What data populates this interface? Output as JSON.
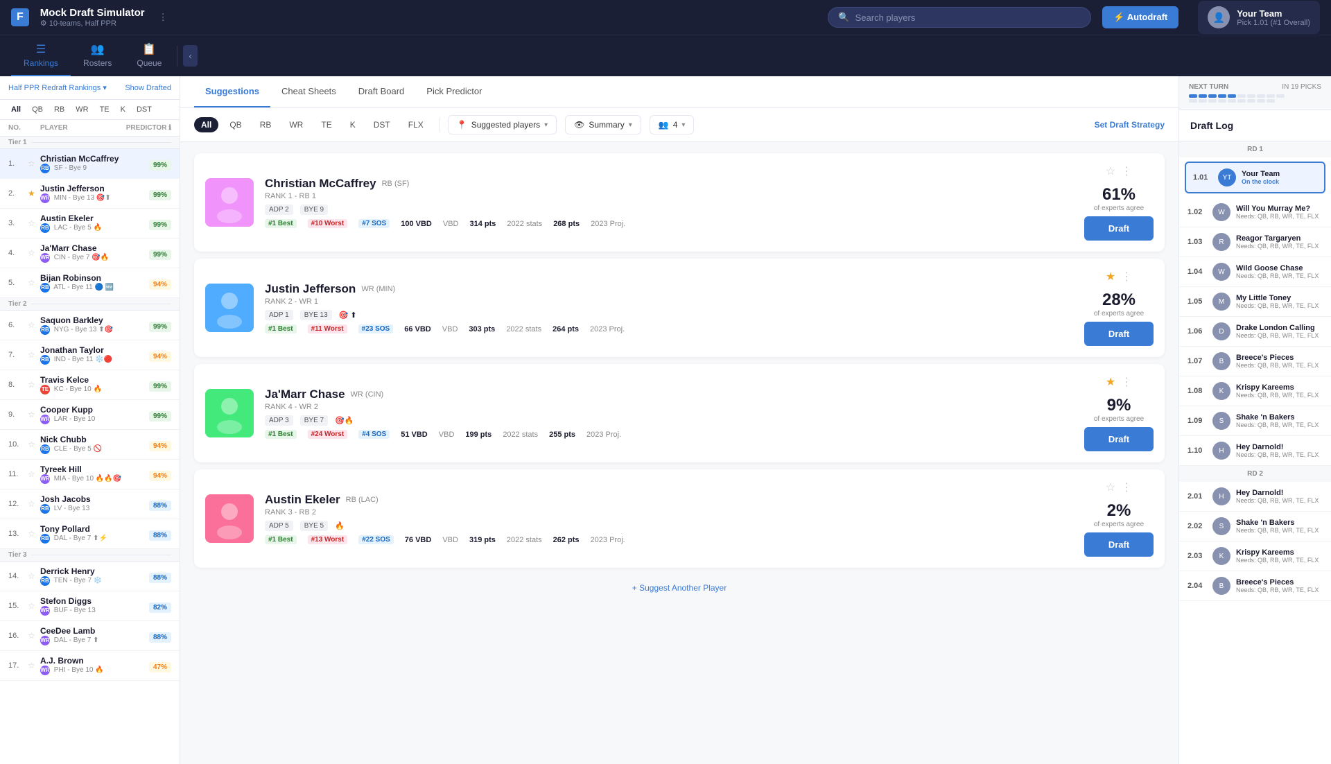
{
  "app": {
    "logo": "F",
    "title": "Mock Draft Simulator",
    "subtitle": "⚙ 10-teams, Half PPR",
    "dots_label": "⋮"
  },
  "search": {
    "placeholder": "Search players"
  },
  "autodraft": {
    "label": "⚡ Autodraft"
  },
  "your_team": {
    "name": "Your Team",
    "pick": "Pick 1.01 (#1 Overall)"
  },
  "nav_tabs": [
    {
      "id": "rankings",
      "label": "Rankings",
      "icon": "☰",
      "active": true
    },
    {
      "id": "rosters",
      "label": "Rosters",
      "icon": "👥",
      "active": false
    },
    {
      "id": "queue",
      "label": "Queue",
      "icon": "📋",
      "active": false
    }
  ],
  "sidebar": {
    "rankings_select": "Half PPR Redraft Rankings ▾",
    "show_drafted": "Show Drafted",
    "position_filters": [
      "All",
      "QB",
      "RB",
      "WR",
      "TE",
      "K",
      "DST"
    ],
    "active_filter": "All",
    "table_header": {
      "no": "NO.",
      "player": "PLAYER",
      "predictor": "PREDICTOR ℹ"
    },
    "tiers": [
      {
        "label": "Tier 1",
        "players": [
          {
            "no": 1,
            "name": "Christian McCaffrey",
            "pos": "RB",
            "team": "SF",
            "bye": "Bye 9",
            "predictor": 99,
            "starred": false
          },
          {
            "no": 2,
            "name": "Justin Jefferson",
            "pos": "WR",
            "team": "MIN",
            "bye": "Bye 13",
            "predictor": 99,
            "starred": true,
            "tags": [
              "target",
              "up"
            ]
          },
          {
            "no": 3,
            "name": "Austin Ekeler",
            "pos": "RB",
            "team": "LAC",
            "bye": "Bye 5",
            "predictor": 99,
            "starred": false,
            "tags": [
              "fire"
            ]
          },
          {
            "no": 4,
            "name": "Ja'Marr Chase",
            "pos": "WR",
            "team": "CIN",
            "bye": "Bye 7",
            "predictor": 99,
            "starred": false,
            "tags": [
              "target",
              "fire"
            ]
          },
          {
            "no": 5,
            "name": "Bijan Robinson",
            "pos": "RB",
            "team": "ATL",
            "bye": "Bye 11",
            "predictor": 94,
            "starred": false,
            "tags": [
              "dot",
              "new"
            ]
          }
        ]
      },
      {
        "label": "Tier 2",
        "players": [
          {
            "no": 6,
            "name": "Saquon Barkley",
            "pos": "RB",
            "team": "NYG",
            "bye": "Bye 13",
            "predictor": 99,
            "starred": false,
            "tags": [
              "up",
              "target"
            ]
          },
          {
            "no": 7,
            "name": "Jonathan Taylor",
            "pos": "RB",
            "team": "IND",
            "bye": "Bye 11",
            "predictor": 94,
            "starred": false,
            "tags": [
              "snow",
              "dot"
            ]
          },
          {
            "no": 8,
            "name": "Travis Kelce",
            "pos": "TE",
            "team": "KC",
            "bye": "Bye 10",
            "predictor": 99,
            "starred": false,
            "tags": [
              "fire"
            ]
          },
          {
            "no": 9,
            "name": "Cooper Kupp",
            "pos": "WR",
            "team": "LAR",
            "bye": "Bye 10",
            "predictor": 99,
            "starred": false
          },
          {
            "no": 10,
            "name": "Nick Chubb",
            "pos": "RB",
            "team": "CLE",
            "bye": "Bye 5",
            "predictor": 94,
            "starred": false,
            "tags": [
              "ban"
            ]
          },
          {
            "no": 11,
            "name": "Tyreek Hill",
            "pos": "WR",
            "team": "MIA",
            "bye": "Bye 10",
            "predictor": 94,
            "starred": false,
            "tags": [
              "fire",
              "fire2",
              "target"
            ]
          },
          {
            "no": 12,
            "name": "Josh Jacobs",
            "pos": "RB",
            "team": "LV",
            "bye": "Bye 13",
            "predictor": 88,
            "starred": false
          },
          {
            "no": 13,
            "name": "Tony Pollard",
            "pos": "RB",
            "team": "DAL",
            "bye": "Bye 7",
            "predictor": 88,
            "starred": false,
            "tags": [
              "up",
              "lightning"
            ]
          }
        ]
      },
      {
        "label": "Tier 3",
        "players": [
          {
            "no": 14,
            "name": "Derrick Henry",
            "pos": "RB",
            "team": "TEN",
            "bye": "Bye 7",
            "predictor": 88,
            "starred": false,
            "tags": [
              "snow"
            ]
          },
          {
            "no": 15,
            "name": "Stefon Diggs",
            "pos": "WR",
            "team": "BUF",
            "bye": "Bye 13",
            "predictor": 82,
            "starred": false
          },
          {
            "no": 16,
            "name": "CeeDee Lamb",
            "pos": "WR",
            "team": "DAL",
            "bye": "Bye 7",
            "predictor": 88,
            "starred": false,
            "tags": [
              "up"
            ]
          },
          {
            "no": 17,
            "name": "A.J. Brown",
            "pos": "WR",
            "team": "PHI",
            "bye": "Bye 10",
            "predictor": 47,
            "starred": false,
            "tags": [
              "fire"
            ]
          }
        ]
      }
    ]
  },
  "center_tabs": [
    "Suggestions",
    "Cheat Sheets",
    "Draft Board",
    "Pick Predictor"
  ],
  "active_center_tab": "Suggestions",
  "position_pills": [
    "All",
    "QB",
    "RB",
    "WR",
    "TE",
    "K",
    "DST",
    "FLX"
  ],
  "active_pill": "All",
  "filters": {
    "players_dropdown": "Suggested players",
    "view_dropdown": "Summary",
    "teams_dropdown": "4",
    "set_strategy": "Set Draft Strategy"
  },
  "player_cards": [
    {
      "id": "mccaffrey",
      "name": "Christian McCaffrey",
      "pos": "RB",
      "team": "SF",
      "rank_label": "RANK 1 - RB 1",
      "adp": "ADP 2",
      "bye": "BYE 9",
      "best": "#1 Best",
      "worst": "#10 Worst",
      "sos": "#7 SOS",
      "vbd": "100 VBD",
      "stats_2022": "314 pts",
      "proj_2023": "268 pts",
      "expert_pct": "61%",
      "expert_label": "of experts agree",
      "starred": false,
      "photo_emoji": "🏈",
      "photo_class": "mccaffrey"
    },
    {
      "id": "jefferson",
      "name": "Justin Jefferson",
      "pos": "WR",
      "team": "MIN",
      "rank_label": "RANK 2 - WR 1",
      "adp": "ADP 1",
      "bye": "BYE 13",
      "best": "#1 Best",
      "worst": "#11 Worst",
      "sos": "#23 SOS",
      "vbd": "66 VBD",
      "stats_2022": "303 pts",
      "proj_2023": "264 pts",
      "expert_pct": "28%",
      "expert_label": "of experts agree",
      "starred": true,
      "photo_emoji": "🏈",
      "photo_class": "jefferson"
    },
    {
      "id": "chase",
      "name": "Ja'Marr Chase",
      "pos": "WR",
      "team": "CIN",
      "rank_label": "RANK 4 - WR 2",
      "adp": "ADP 3",
      "bye": "BYE 7",
      "best": "#1 Best",
      "worst": "#24 Worst",
      "sos": "#4 SOS",
      "vbd": "51 VBD",
      "stats_2022": "199 pts",
      "proj_2023": "255 pts",
      "expert_pct": "9%",
      "expert_label": "of experts agree",
      "starred": true,
      "photo_emoji": "🏈",
      "photo_class": "chase"
    },
    {
      "id": "ekeler",
      "name": "Austin Ekeler",
      "pos": "RB",
      "team": "LAC",
      "rank_label": "RANK 3 - RB 2",
      "adp": "ADP 5",
      "bye": "BYE 5",
      "best": "#1 Best",
      "worst": "#13 Worst",
      "sos": "#22 SOS",
      "vbd": "76 VBD",
      "stats_2022": "319 pts",
      "proj_2023": "262 pts",
      "expert_pct": "2%",
      "expert_label": "of experts agree",
      "starred": false,
      "photo_emoji": "🏈",
      "photo_class": "ekeler"
    }
  ],
  "suggest_another": "+ Suggest Another Player",
  "right_sidebar": {
    "title": "Draft Log",
    "next_turn_label": "NEXT TURN",
    "in_picks": "IN 19 PICKS",
    "rounds": [
      {
        "label": "RD 1",
        "picks": [
          {
            "num": "1.01",
            "team": "Your Team",
            "sub": "On the clock",
            "type": "your_active"
          },
          {
            "num": "1.02",
            "team": "Will You Murray Me?",
            "needs": "Needs: QB, RB, WR, TE, FLX",
            "type": "other"
          },
          {
            "num": "1.03",
            "team": "Reagor Targaryen",
            "needs": "Needs: QB, RB, WR, TE, FLX",
            "type": "other"
          },
          {
            "num": "1.04",
            "team": "Wild Goose Chase",
            "needs": "Needs: QB, RB, WR, TE, FLX",
            "type": "other"
          },
          {
            "num": "1.05",
            "team": "My Little Toney",
            "needs": "Needs: QB, RB, WR, TE, FLX",
            "type": "other"
          },
          {
            "num": "1.06",
            "team": "Drake London Calling",
            "needs": "Needs: QB, RB, WR, TE, FLX",
            "type": "other"
          },
          {
            "num": "1.07",
            "team": "Breece's Pieces",
            "needs": "Needs: QB, RB, WR, TE, FLX",
            "type": "other"
          },
          {
            "num": "1.08",
            "team": "Krispy Kareems",
            "needs": "Needs: QB, RB, WR, TE, FLX",
            "type": "other"
          },
          {
            "num": "1.09",
            "team": "Shake 'n Bakers",
            "needs": "Needs: QB, RB, WR, TE, FLX",
            "type": "other"
          },
          {
            "num": "1.10",
            "team": "Hey Darnold!",
            "needs": "Needs: QB, RB, WR, TE, FLX",
            "type": "other"
          }
        ]
      },
      {
        "label": "RD 2",
        "picks": [
          {
            "num": "2.01",
            "team": "Hey Darnold!",
            "needs": "Needs: QB, RB, WR, TE, FLX",
            "type": "other"
          },
          {
            "num": "2.02",
            "team": "Shake 'n Bakers",
            "needs": "Needs: QB, RB, WR, TE, FLX",
            "type": "other"
          },
          {
            "num": "2.03",
            "team": "Krispy Kareems",
            "needs": "Needs: QB, RB, WR, TE, FLX",
            "type": "other"
          },
          {
            "num": "2.04",
            "team": "Breece's Pieces",
            "needs": "Needs: QB, RB, WR, TE, FLX",
            "type": "other"
          }
        ]
      }
    ]
  }
}
